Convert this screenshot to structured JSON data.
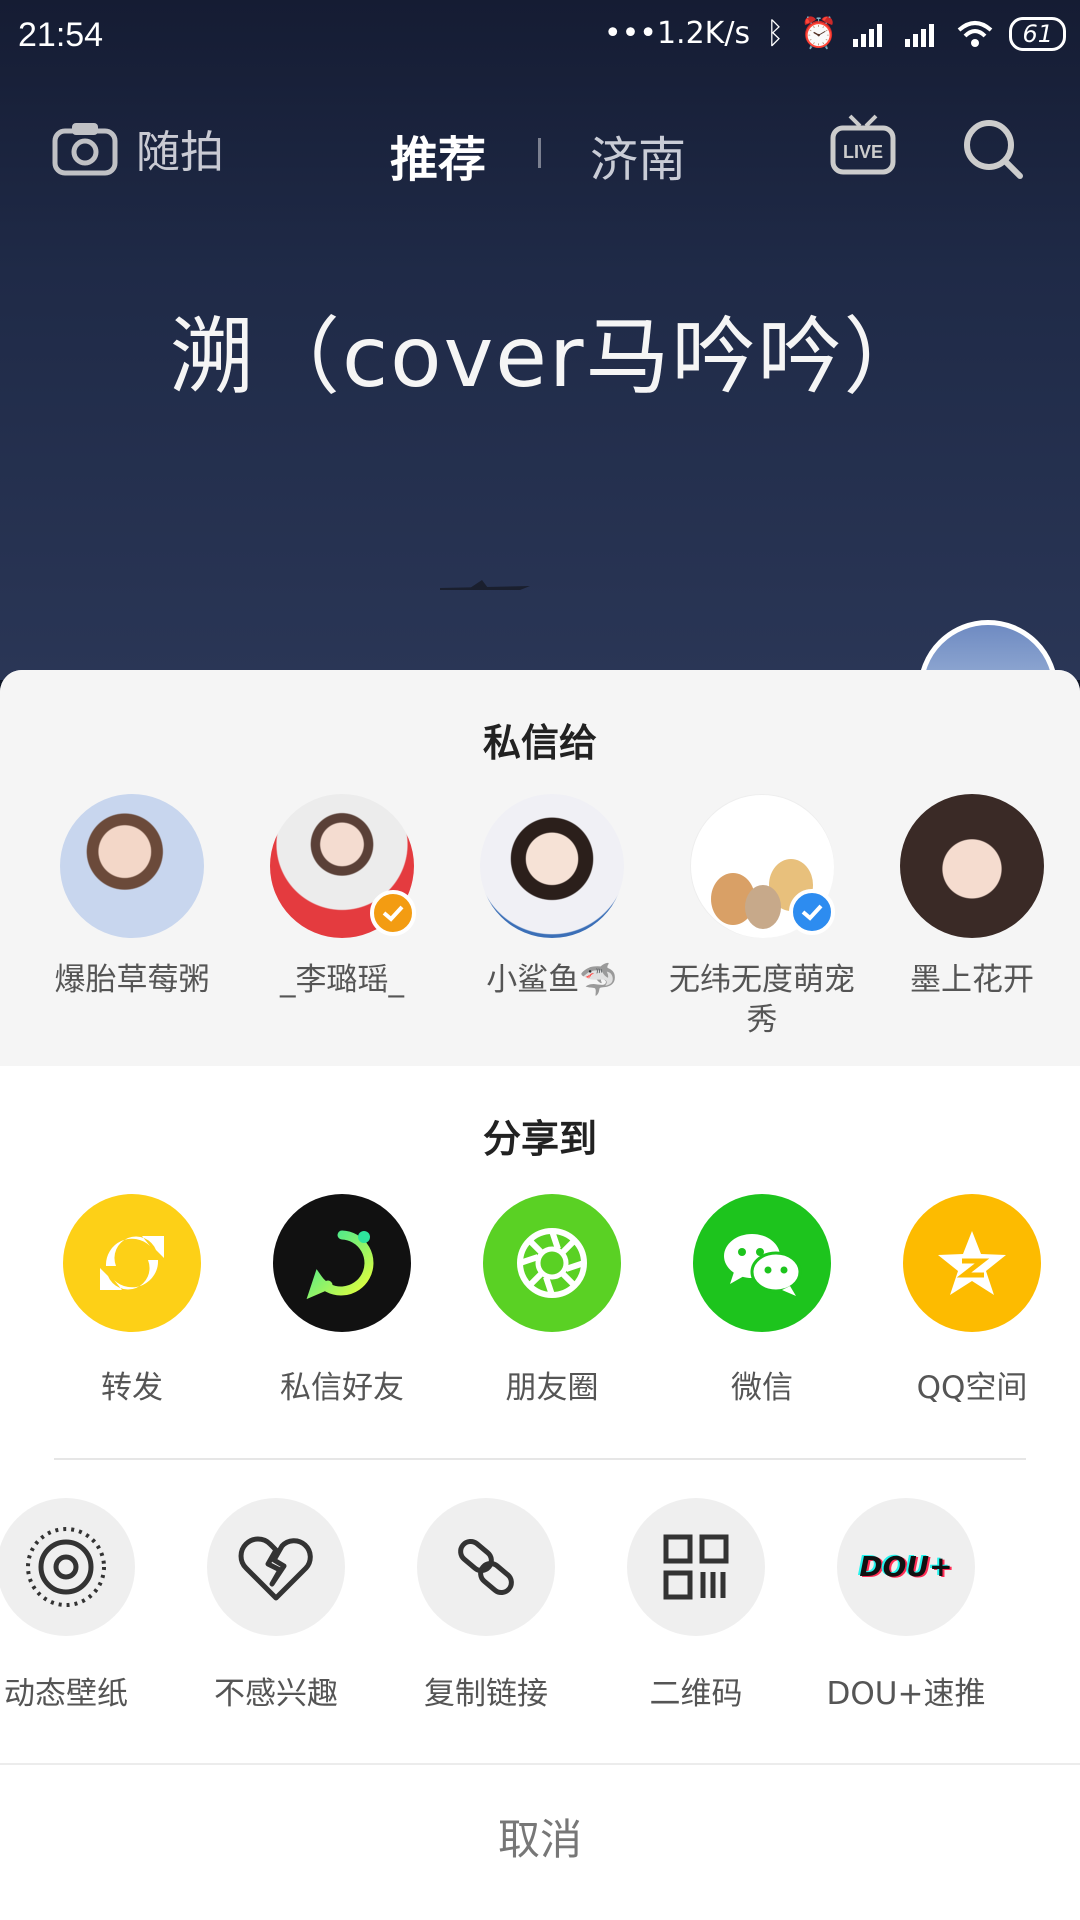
{
  "status": {
    "time": "21:54",
    "network_speed": "1.2K/s",
    "battery": "61"
  },
  "topnav": {
    "camera_label": "随拍",
    "tab_recommend": "推荐",
    "tab_city": "济南",
    "live_icon": "live-tv-icon",
    "search_icon": "search-icon"
  },
  "video": {
    "title": "溯（cover马吟吟）"
  },
  "sheet": {
    "dm_title": "私信给",
    "contacts": [
      {
        "name": "爆胎草莓粥",
        "color": "#b9c7e0",
        "verified": false
      },
      {
        "name": "_李璐瑶_",
        "color": "#e83a3f",
        "verified": true,
        "badge_color": "#f39c12"
      },
      {
        "name": "小鲨鱼🦈",
        "color": "#f0e6de",
        "verified": false
      },
      {
        "name": "无纬无度萌宠秀",
        "color": "#ffffff",
        "verified": true,
        "badge_color": "#2d8cf0"
      },
      {
        "name": "墨上花开",
        "color": "#4a3a36",
        "verified": false
      }
    ],
    "share_title": "分享到",
    "share_items": [
      {
        "label": "转发",
        "color": "#fdd017",
        "icon": "repost-icon"
      },
      {
        "label": "私信好友",
        "color": "#111111",
        "icon": "message-friend-icon"
      },
      {
        "label": "朋友圈",
        "color": "#5ad124",
        "icon": "moments-icon"
      },
      {
        "label": "微信",
        "color": "#1dc41d",
        "icon": "wechat-icon"
      },
      {
        "label": "QQ空间",
        "color": "#fdbb00",
        "icon": "qzone-icon"
      }
    ],
    "tools": [
      {
        "label": "动态壁纸",
        "icon": "live-wallpaper-icon"
      },
      {
        "label": "不感兴趣",
        "icon": "broken-heart-icon"
      },
      {
        "label": "复制链接",
        "icon": "link-icon"
      },
      {
        "label": "二维码",
        "icon": "qr-code-icon"
      },
      {
        "label": "DOU+速推",
        "icon": "dou-plus-icon"
      }
    ],
    "cancel_label": "取消"
  }
}
